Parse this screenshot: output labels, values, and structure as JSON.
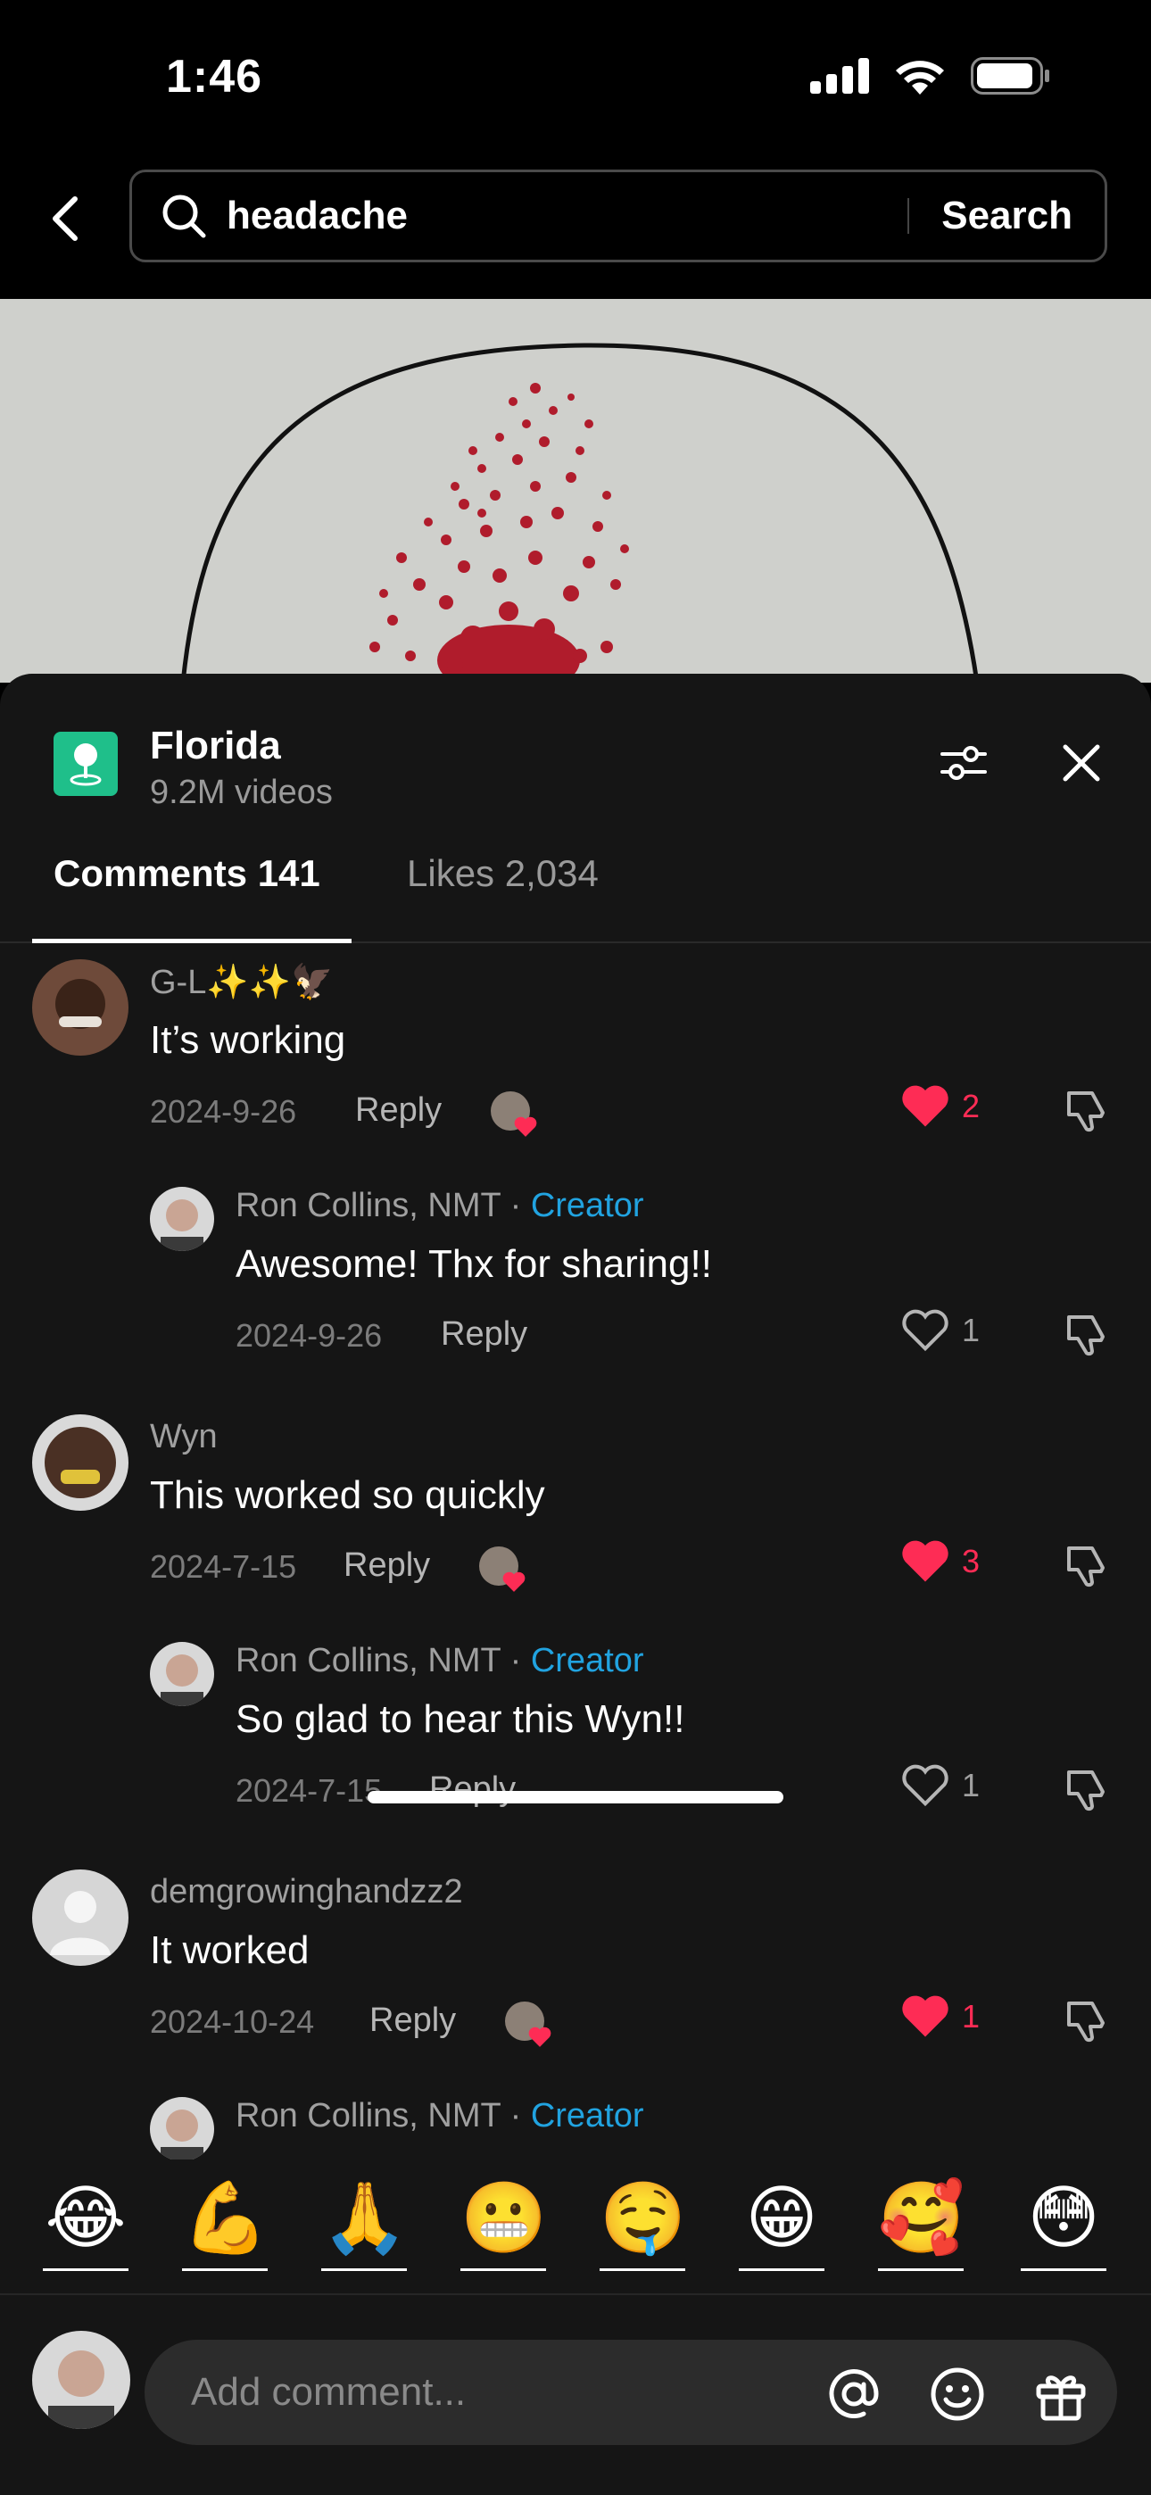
{
  "status": {
    "time": "1:46"
  },
  "search": {
    "query": "headache",
    "button_label": "Search"
  },
  "location": {
    "title": "Florida",
    "subtitle": "9.2M videos"
  },
  "tabs": {
    "comments": "Comments 141",
    "likes": "Likes 2,034"
  },
  "comments": [
    {
      "user": "G-L✨✨🦅",
      "text": "It’s working",
      "date": "2024-9-26",
      "reply": "Reply",
      "likes": "2"
    },
    {
      "user": "Ron Collins, NMT",
      "badge": "Creator",
      "text": "Awesome! Thx for sharing!!",
      "date": "2024-9-26",
      "reply": "Reply",
      "likes": "1"
    },
    {
      "user": "Wyn",
      "text": "This worked so quickly",
      "date": "2024-7-15",
      "reply": "Reply",
      "likes": "3"
    },
    {
      "user": "Ron Collins, NMT",
      "badge": "Creator",
      "text": "So glad to hear this Wyn!!",
      "date": "2024-7-15",
      "reply": "Reply",
      "likes": "1"
    },
    {
      "user": "demgrowinghandzz2",
      "text": "It worked",
      "date": "2024-10-24",
      "reply": "Reply",
      "likes": "1"
    },
    {
      "user": "Ron Collins, NMT",
      "badge": "Creator"
    }
  ],
  "separator": " · ",
  "emojis": [
    "😂",
    "💪",
    "🙏",
    "😬",
    "🤤",
    "😁",
    "🥰",
    "😳"
  ],
  "composer": {
    "placeholder": "Add comment..."
  },
  "colors": {
    "accent_like": "#fe2c55",
    "creator_badge": "#21a3e0",
    "location_icon": "#1fbf8a",
    "sheet_bg": "#151515"
  }
}
